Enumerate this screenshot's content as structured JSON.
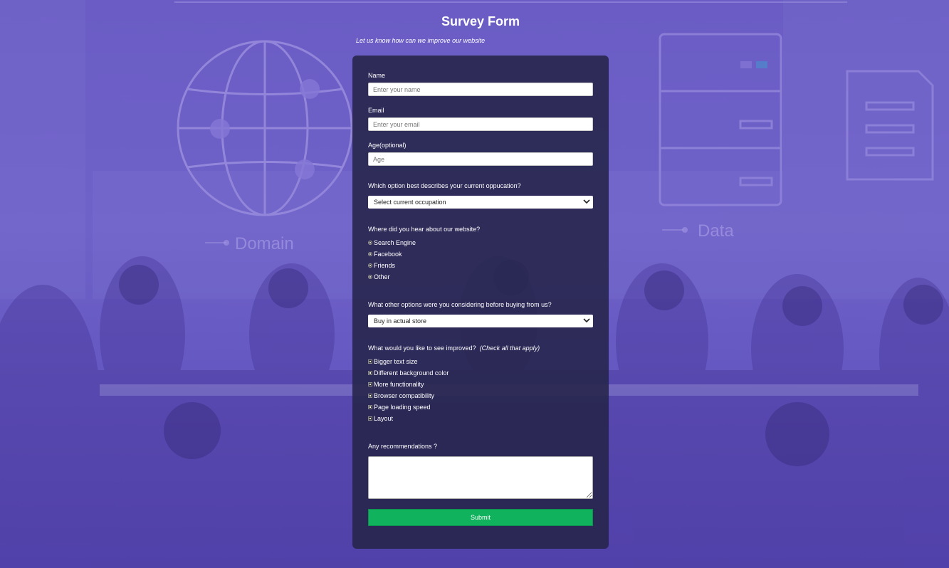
{
  "header": {
    "title": "Survey Form",
    "subtitle": "Let us know how can we improve our website"
  },
  "background": {
    "label_domain": "Domain",
    "label_data": "Data"
  },
  "form": {
    "name_label": "Name",
    "name_placeholder": "Enter your name",
    "email_label": "Email",
    "email_placeholder": "Enter your email",
    "age_label": "Age(optional)",
    "age_placeholder": "Age",
    "occupation_label": "Which option best describes your current oppucation?",
    "occupation_selected": "Select current occupation",
    "heard_label": "Where did you hear about our website?",
    "heard_options": [
      "Search Engine",
      "Facebook",
      "Friends",
      "Other"
    ],
    "considering_label": "What other options were you considering before buying from us?",
    "considering_selected": "Buy in actual store",
    "improve_label": "What would you like to see improved?",
    "improve_hint": "(Check all that apply)",
    "improve_options": [
      "Bigger text size",
      "Different background color",
      "More functionality",
      "Browser compatibility",
      "Page loading speed",
      "Layout"
    ],
    "recommend_label": "Any recommendations ?",
    "submit_label": "Submit"
  },
  "colors": {
    "accent_submit": "#11b25e",
    "card_bg": "#26244a",
    "page_bg": "#6a5cc4"
  }
}
